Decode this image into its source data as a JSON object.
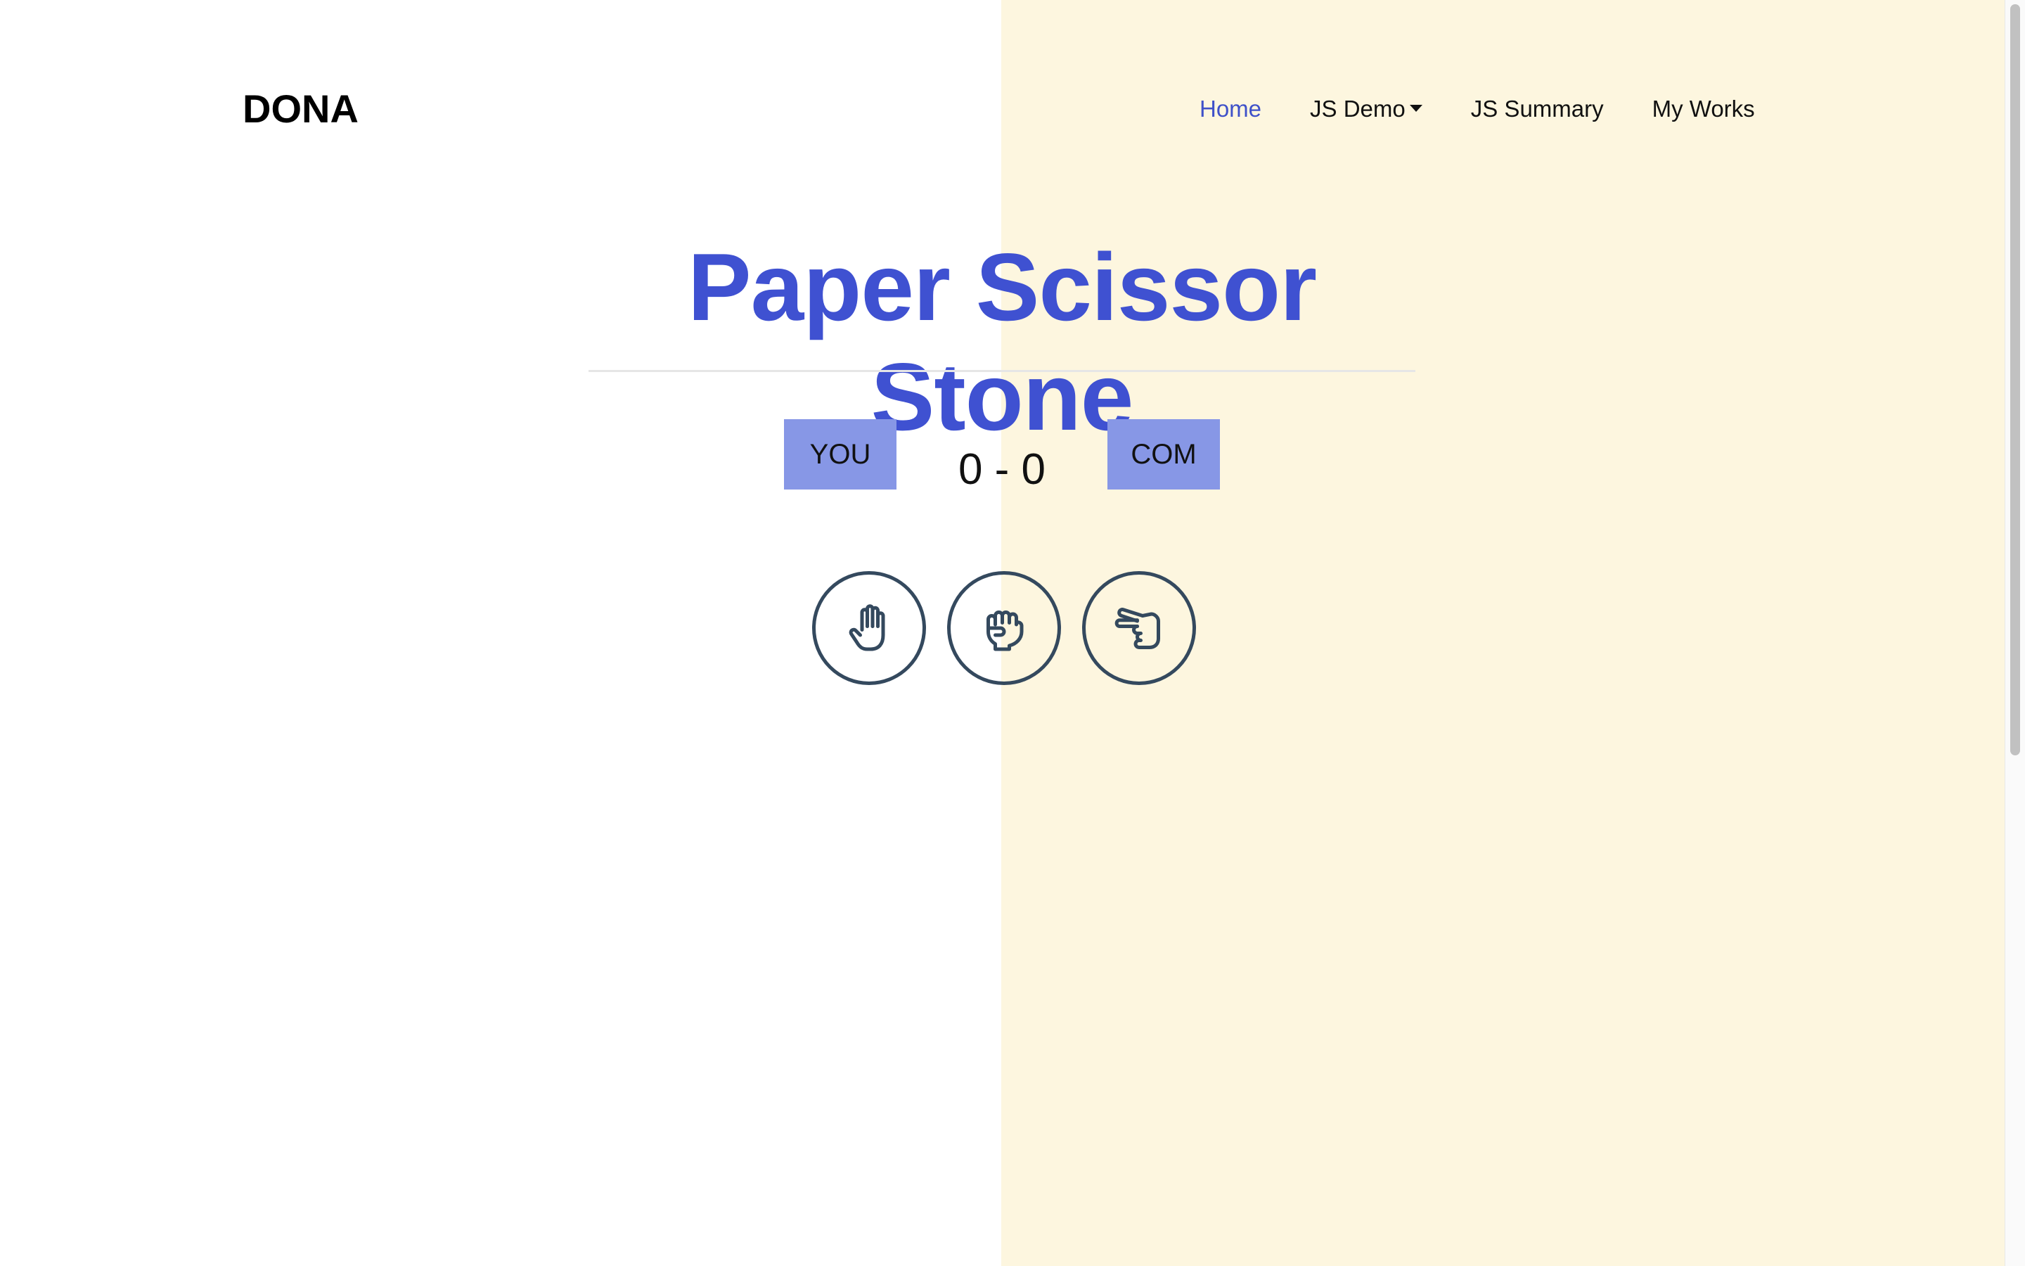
{
  "brand": "DONA",
  "nav": {
    "home": "Home",
    "js_demo": "JS Demo",
    "js_summary": "JS Summary",
    "my_works": "My Works"
  },
  "game": {
    "title": "Paper Scissor Stone",
    "player_label": "YOU",
    "computer_label": "COM",
    "score": "0 - 0",
    "choices": [
      {
        "name": "paper",
        "icon": "hand-paper-icon"
      },
      {
        "name": "stone",
        "icon": "hand-rock-icon"
      },
      {
        "name": "scissor",
        "icon": "hand-scissors-icon"
      }
    ]
  },
  "colors": {
    "accent": "#3f51d1",
    "badge": "#8797e6",
    "icon_stroke": "#34495e",
    "right_bg": "#fdf6df"
  }
}
